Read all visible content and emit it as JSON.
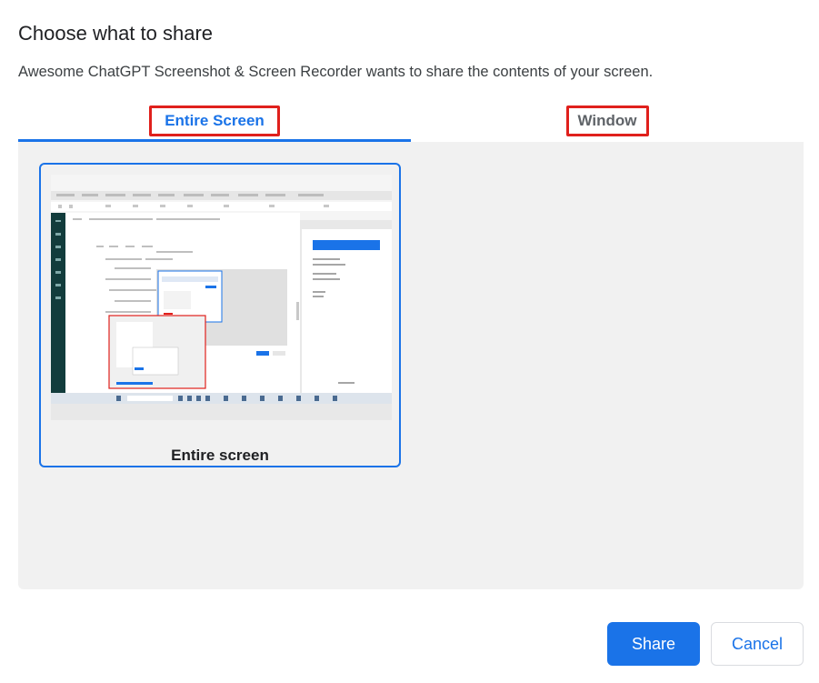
{
  "dialog": {
    "title": "Choose what to share",
    "description": "Awesome ChatGPT Screenshot & Screen Recorder wants to share the contents of your screen."
  },
  "tabs": [
    {
      "label": "Entire Screen",
      "active": true
    },
    {
      "label": "Window",
      "active": false
    }
  ],
  "sources": [
    {
      "label": "Entire screen",
      "selected": true
    }
  ],
  "buttons": {
    "share": "Share",
    "cancel": "Cancel"
  },
  "colors": {
    "accent": "#1a73e8",
    "highlight": "#e0201c",
    "panel": "#f1f1f1"
  }
}
